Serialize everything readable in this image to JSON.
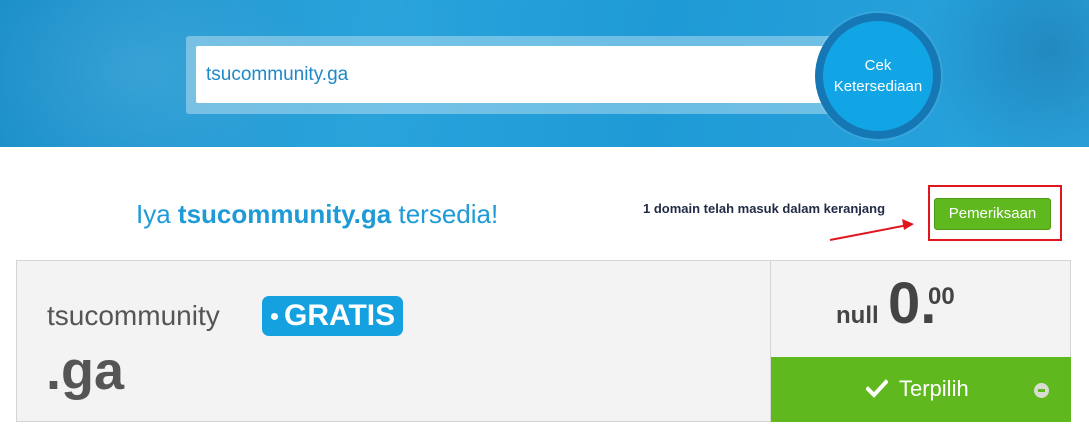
{
  "search": {
    "value": "tsucommunity.ga",
    "button_label_line1": "Cek",
    "button_label_line2": "Ketersediaan"
  },
  "availability": {
    "prefix": "Iya ",
    "domain": "tsucommunity.ga",
    "suffix": " tersedia!"
  },
  "cart": {
    "note": "1 domain telah masuk dalam keranjang",
    "checkout_label": "Pemeriksaan"
  },
  "result": {
    "name": "tsucommunity",
    "tld": ".ga",
    "badge": "GRATIS",
    "currency": "null",
    "price_whole": "0.",
    "price_fraction": "00",
    "selected_label": "Terpilih"
  },
  "colors": {
    "brand_blue": "#15a1e0",
    "green": "#5fb81e",
    "highlight_red": "#e0161e"
  },
  "icons": {
    "check": "check-icon",
    "remove": "minus-circle-icon"
  }
}
